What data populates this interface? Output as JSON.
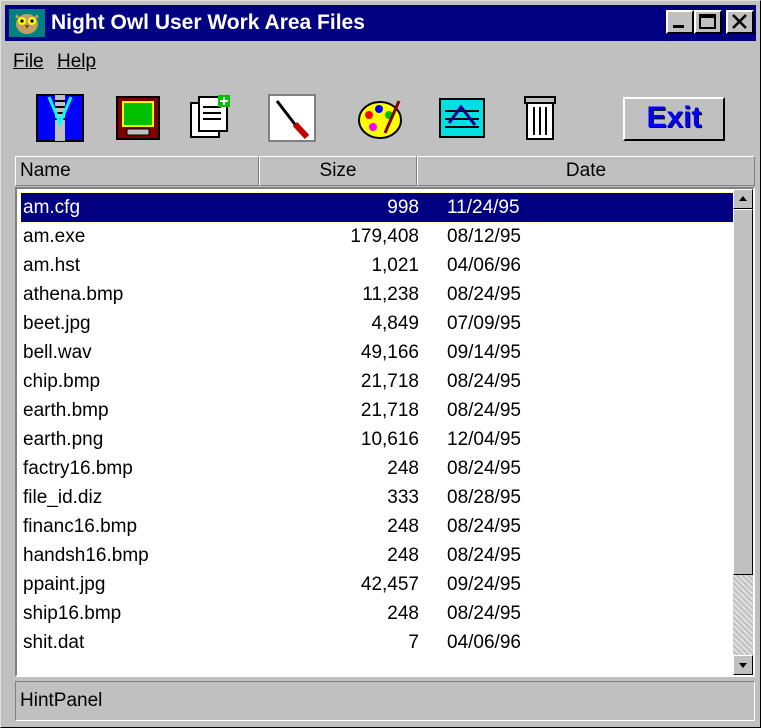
{
  "window": {
    "title": "Night Owl User Work Area Files",
    "controls": {
      "minimize": "_",
      "maximize": "□",
      "close": "✕"
    }
  },
  "menu": [
    {
      "label": "File"
    },
    {
      "label": "Help"
    }
  ],
  "toolbar": {
    "icons": [
      "zip-icon",
      "monitor-icon",
      "copy-new-icon",
      "knife-icon",
      "palette-icon",
      "scan-image-icon",
      "trash-can-icon"
    ],
    "exit_label": "Exit"
  },
  "columns": {
    "name": "Name",
    "size": "Size",
    "date": "Date"
  },
  "files": [
    {
      "name": "am.cfg",
      "size": "998",
      "date": "11/24/95",
      "selected": true
    },
    {
      "name": "am.exe",
      "size": "179,408",
      "date": "08/12/95"
    },
    {
      "name": "am.hst",
      "size": "1,021",
      "date": "04/06/96"
    },
    {
      "name": "athena.bmp",
      "size": "11,238",
      "date": "08/24/95"
    },
    {
      "name": "beet.jpg",
      "size": "4,849",
      "date": "07/09/95"
    },
    {
      "name": "bell.wav",
      "size": "49,166",
      "date": "09/14/95"
    },
    {
      "name": "chip.bmp",
      "size": "21,718",
      "date": "08/24/95"
    },
    {
      "name": "earth.bmp",
      "size": "21,718",
      "date": "08/24/95"
    },
    {
      "name": "earth.png",
      "size": "10,616",
      "date": "12/04/95"
    },
    {
      "name": "factry16.bmp",
      "size": "248",
      "date": "08/24/95"
    },
    {
      "name": "file_id.diz",
      "size": "333",
      "date": "08/28/95"
    },
    {
      "name": "financ16.bmp",
      "size": "248",
      "date": "08/24/95"
    },
    {
      "name": "handsh16.bmp",
      "size": "248",
      "date": "08/24/95"
    },
    {
      "name": "ppaint.jpg",
      "size": "42,457",
      "date": "09/24/95"
    },
    {
      "name": "ship16.bmp",
      "size": "248",
      "date": "08/24/95"
    },
    {
      "name": "shit.dat",
      "size": "7",
      "date": "04/06/96"
    }
  ],
  "hint_panel": "HintPanel",
  "colors": {
    "title_bar": "#000080",
    "selection": "#000080",
    "exit_text": "#0000ff",
    "face": "#c0c0c0"
  }
}
